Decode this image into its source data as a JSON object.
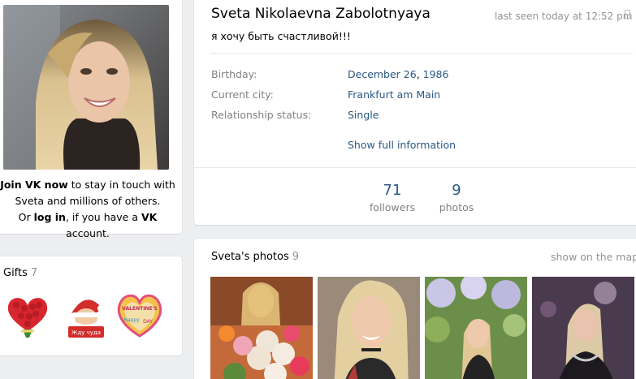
{
  "profile": {
    "name": "Sveta Nikolaevna Zabolotnyaya",
    "last_seen": "last seen today at 12:52 pm",
    "status": "я хочу быть счастливой!!!",
    "join": {
      "line1_bold": "Join VK now",
      "line1_rest": " to stay in touch with",
      "line2": "Sveta and millions of others.",
      "line3_pre": "Or ",
      "line3_link": "log in",
      "line3_mid": ", if you have a ",
      "line3_bold": "VK",
      "line3_post": " account."
    }
  },
  "info": {
    "birthday_label": "Birthday:",
    "birthday_day": "December 26",
    "birthday_sep": ", ",
    "birthday_year": "1986",
    "city_label": "Current city:",
    "city_value": "Frankfurt am Main",
    "relationship_label": "Relationship status:",
    "relationship_value": "Single",
    "show_full": "Show full information"
  },
  "counters": {
    "followers_count": "71",
    "followers_label": "followers",
    "photos_count": "9",
    "photos_label": "photos"
  },
  "gifts": {
    "title": "Gifts",
    "count": "7",
    "items": [
      "heart-roses-gift",
      "santa-gift",
      "valentines-heart-gift"
    ],
    "santa_text": "Жду чуда",
    "valentine_line1": "VALENTINE'S",
    "valentine_line2": "Happy",
    "valentine_line3": "DAY"
  },
  "photos": {
    "title": "Sveta's photos",
    "count": "9",
    "map_link": "show on the map"
  },
  "colors": {
    "link": "#2a5885",
    "muted": "#828282",
    "background": "#edeef0"
  }
}
